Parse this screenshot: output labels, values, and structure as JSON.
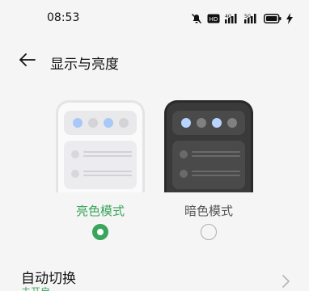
{
  "status_bar": {
    "time": "08:53",
    "icons": [
      "mute-icon",
      "hd-icon",
      "signal-4g-icon",
      "signal-5g-icon",
      "battery-icon",
      "charging-icon"
    ],
    "hd_label": "HD",
    "net1_label": "4G",
    "net2_label": "5G"
  },
  "header": {
    "title": "显示与亮度",
    "back_icon": "arrow-left-icon"
  },
  "modes": {
    "light": {
      "label": "亮色模式",
      "selected": true
    },
    "dark": {
      "label": "暗色模式",
      "selected": false
    }
  },
  "auto_switch": {
    "title": "自动切换",
    "subtitle": "未开启",
    "chevron_icon": "chevron-right-icon"
  },
  "colors": {
    "accent": "#3aa55c",
    "background": "#f5f5f5",
    "dot_blue_light": "#a8c8f5",
    "dot_gray_light": "#d4d4d8",
    "dot_blue_dark": "#b8d4ff",
    "dot_gray_dark": "#808080"
  }
}
